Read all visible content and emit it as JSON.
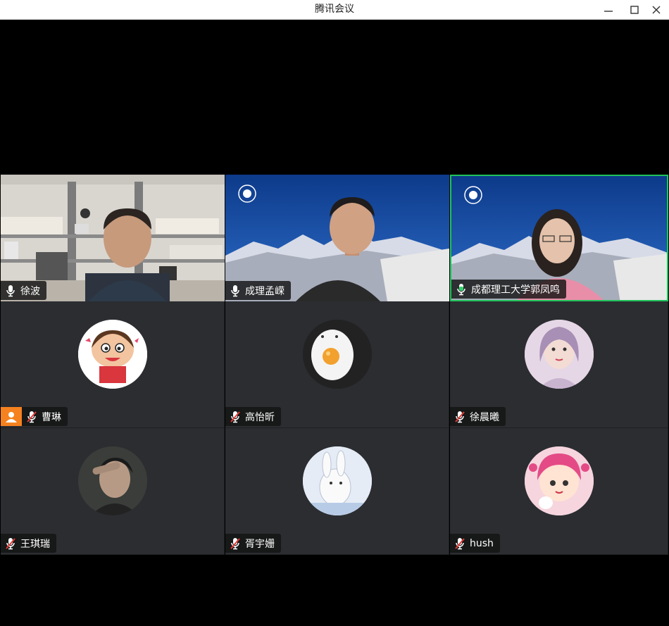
{
  "window": {
    "title": "腾讯会议"
  },
  "participants": [
    {
      "name": "徐波",
      "mic": "on",
      "video": true
    },
    {
      "name": "成理孟嵘",
      "mic": "on",
      "video": true
    },
    {
      "name": "成都理工大学郭凤鸣",
      "mic": "speaking",
      "video": true
    },
    {
      "name": "曹琳",
      "mic": "muted",
      "video": false,
      "host": true
    },
    {
      "name": "高怡昕",
      "mic": "muted",
      "video": false
    },
    {
      "name": "徐晨曦",
      "mic": "muted",
      "video": false
    },
    {
      "name": "王琪瑞",
      "mic": "muted",
      "video": false
    },
    {
      "name": "胥宇姗",
      "mic": "muted",
      "video": false
    },
    {
      "name": "hush",
      "mic": "muted",
      "video": false
    }
  ],
  "colors": {
    "speaking_border": "#21c35a",
    "host_badge": "#f5821f",
    "tile_bg": "#2b2d31",
    "muted_slash": "#e53935"
  },
  "icons": {
    "mic_on": "microphone-icon",
    "mic_speaking": "microphone-active-icon",
    "mic_muted": "microphone-muted-icon",
    "host": "person-icon"
  }
}
